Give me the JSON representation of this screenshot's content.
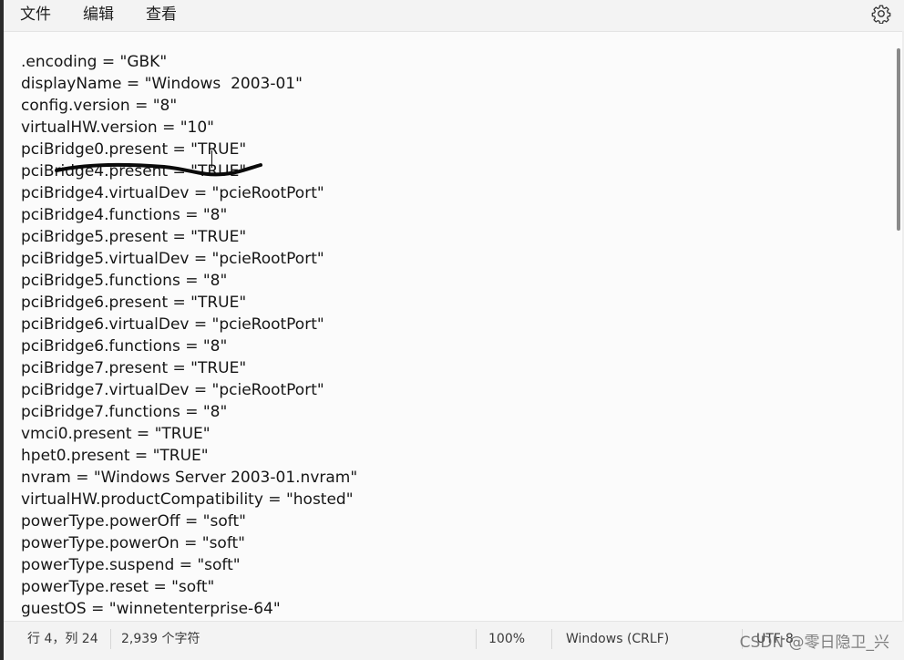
{
  "menu": {
    "items": [
      {
        "label": "文件"
      },
      {
        "label": "编辑"
      },
      {
        "label": "查看"
      }
    ],
    "settings_icon": "gear-icon"
  },
  "editor": {
    "lines": [
      ".encoding = \"GBK\"",
      "displayName = \"Windows  2003-01\"",
      "config.version = \"8\"",
      "virtualHW.version = \"10\"",
      "pciBridge0.present = \"TRUE\"",
      "pciBridge4.present = \"TRUE\"",
      "pciBridge4.virtualDev = \"pcieRootPort\"",
      "pciBridge4.functions = \"8\"",
      "pciBridge5.present = \"TRUE\"",
      "pciBridge5.virtualDev = \"pcieRootPort\"",
      "pciBridge5.functions = \"8\"",
      "pciBridge6.present = \"TRUE\"",
      "pciBridge6.virtualDev = \"pcieRootPort\"",
      "pciBridge6.functions = \"8\"",
      "pciBridge7.present = \"TRUE\"",
      "pciBridge7.virtualDev = \"pcieRootPort\"",
      "pciBridge7.functions = \"8\"",
      "vmci0.present = \"TRUE\"",
      "hpet0.present = \"TRUE\"",
      "nvram = \"Windows Server 2003-01.nvram\"",
      "virtualHW.productCompatibility = \"hosted\"",
      "powerType.powerOff = \"soft\"",
      "powerType.powerOn = \"soft\"",
      "powerType.suspend = \"soft\"",
      "powerType.reset = \"soft\"",
      "guestOS = \"winnetenterprise-64\""
    ]
  },
  "status": {
    "position": "行 4，列 24",
    "char_count": "2,939 个字符",
    "zoom": "100%",
    "line_ending": "Windows (CRLF)",
    "encoding": "UTF-8"
  },
  "watermark": "CSDN @零日隐卫_兴",
  "colors": {
    "menubar_bg": "#f3f3f3",
    "editor_bg": "#fbfbfb",
    "text": "#161616",
    "ink_annotation": "#0a0a0a"
  }
}
